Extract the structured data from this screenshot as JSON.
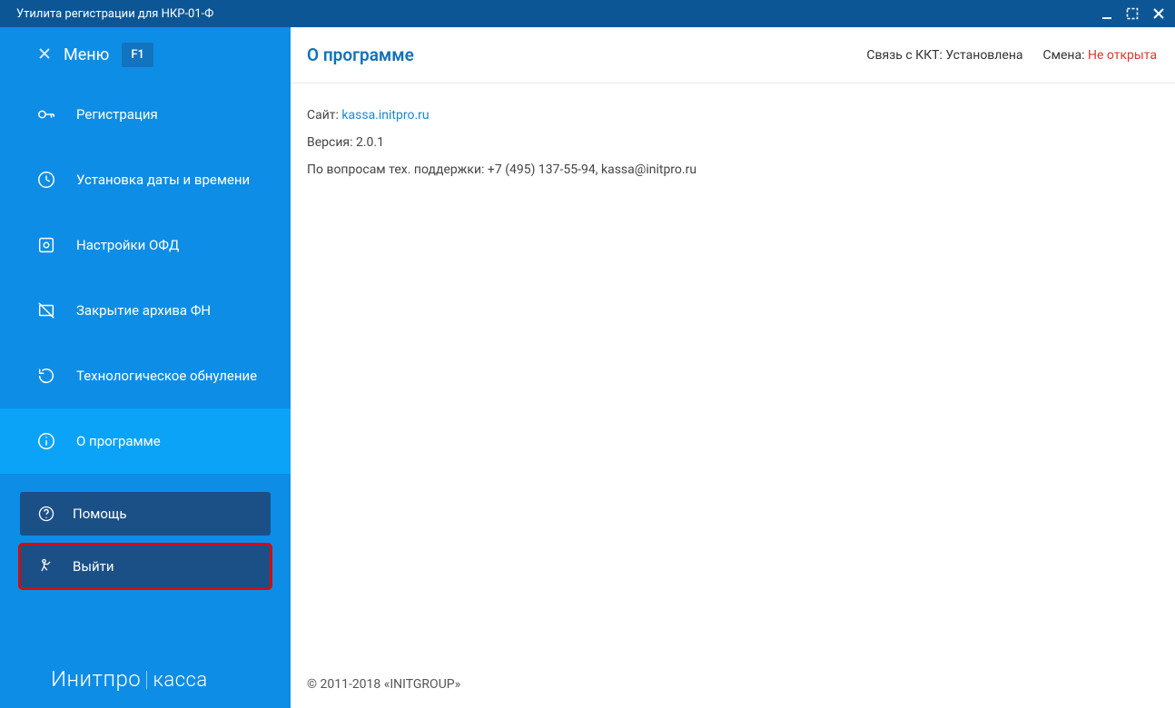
{
  "window": {
    "title": "Утилита регистрации для НКР-01-Ф"
  },
  "sidebar": {
    "menu_label": "Меню",
    "menu_hotkey": "F1",
    "items": [
      {
        "id": "register",
        "label": "Регистрация"
      },
      {
        "id": "datetime",
        "label": "Установка даты и времени"
      },
      {
        "id": "ofd",
        "label": "Настройки ОФД"
      },
      {
        "id": "archive",
        "label": "Закрытие архива ФН"
      },
      {
        "id": "reset",
        "label": "Технологическое обнуление"
      },
      {
        "id": "about",
        "label": "О программе"
      }
    ],
    "bottom": {
      "help": "Помощь",
      "exit": "Выйти"
    },
    "brand_main": "Инитпро",
    "brand_sub": "касса"
  },
  "header": {
    "title": "О программе",
    "kkt_label": "Связь с ККТ: ",
    "kkt_value": "Установлена",
    "shift_label": "Смена: ",
    "shift_value": "Не открыта"
  },
  "about": {
    "site_label": "Сайт: ",
    "site_link": "kassa.initpro.ru",
    "version_label": "Версия: ",
    "version_value": "2.0.1",
    "support_label": "По вопросам тех. поддержки: ",
    "support_value": "+7 (495) 137-55-94, kassa@initpro.ru"
  },
  "footer": {
    "copyright": "© 2011-2018 «INITGROUP»"
  }
}
